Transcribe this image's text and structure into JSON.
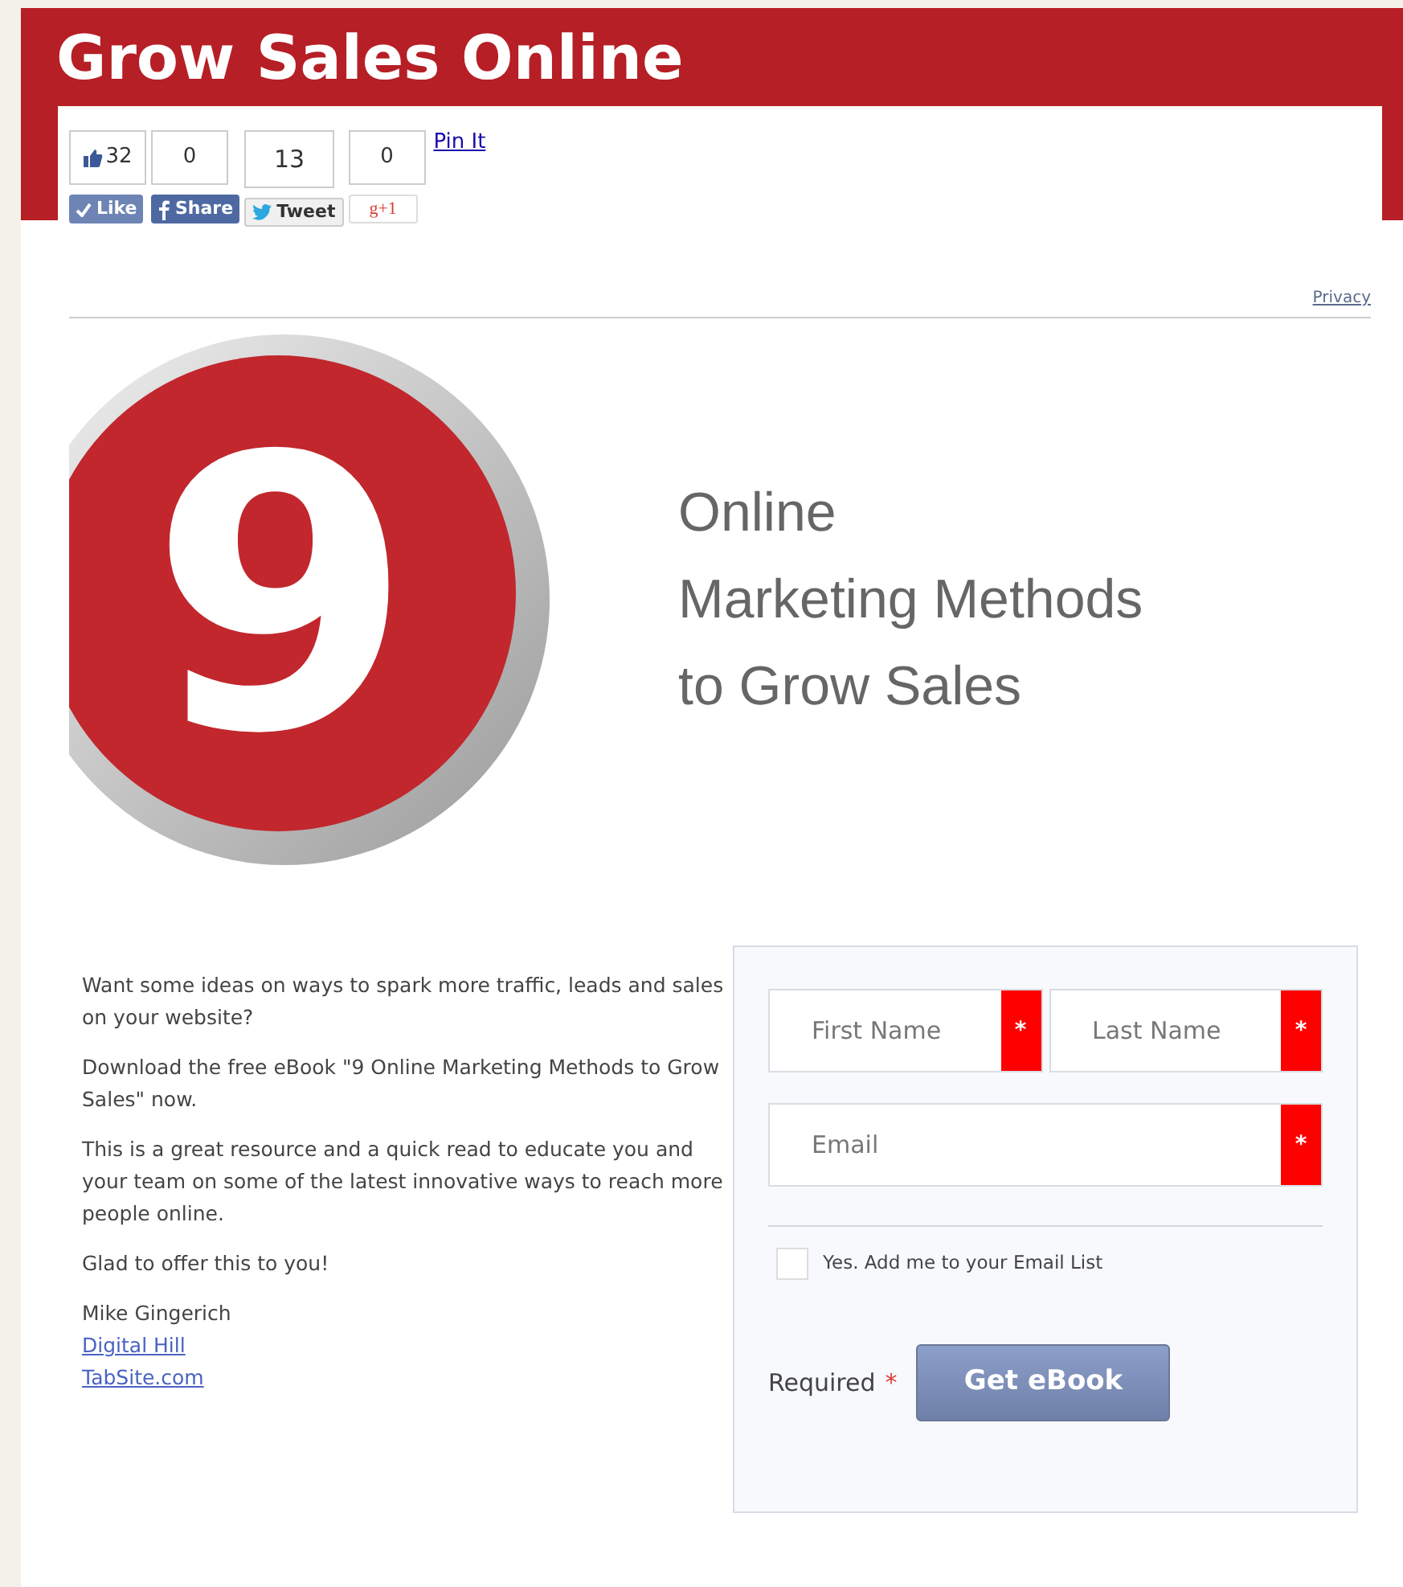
{
  "header": {
    "title": "Grow Sales Online"
  },
  "social": [
    {
      "kind": "like",
      "count": "32",
      "label": "Like"
    },
    {
      "kind": "share",
      "count": "0",
      "label": "Share"
    },
    {
      "kind": "tweet",
      "count": "13",
      "label": "Tweet"
    },
    {
      "kind": "plusone",
      "count": "0",
      "label": "g+1"
    }
  ],
  "pin_link": "Pin It",
  "privacy_link": "Privacy",
  "hero": {
    "logo_number": "9",
    "title_lines": [
      "Online",
      "Marketing Methods",
      "to Grow Sales"
    ]
  },
  "intro": {
    "paragraphs": [
      "Want some ideas on ways to spark more traffic, leads and sales on your website?",
      "Download the free eBook \"9 Online Marketing Methods to Grow Sales\" now.",
      "This is a great resource and a quick read to educate you and your team on some of the latest innovative ways to reach more people online.",
      "Glad to offer this to you!"
    ],
    "author": "Mike Gingerich",
    "links": [
      "Digital Hill",
      "TabSite.com"
    ]
  },
  "form": {
    "name_fields": [
      {
        "placeholder": "First Name",
        "mark": "*"
      },
      {
        "placeholder": "Last Name",
        "mark": "*"
      }
    ],
    "email_field": {
      "placeholder": "Email",
      "mark": "*"
    },
    "checkbox": {
      "label": "Yes. Add me to your Email List",
      "checked": false
    },
    "required_label": "Required",
    "required_mark": "*",
    "submit": "Get eBook"
  }
}
